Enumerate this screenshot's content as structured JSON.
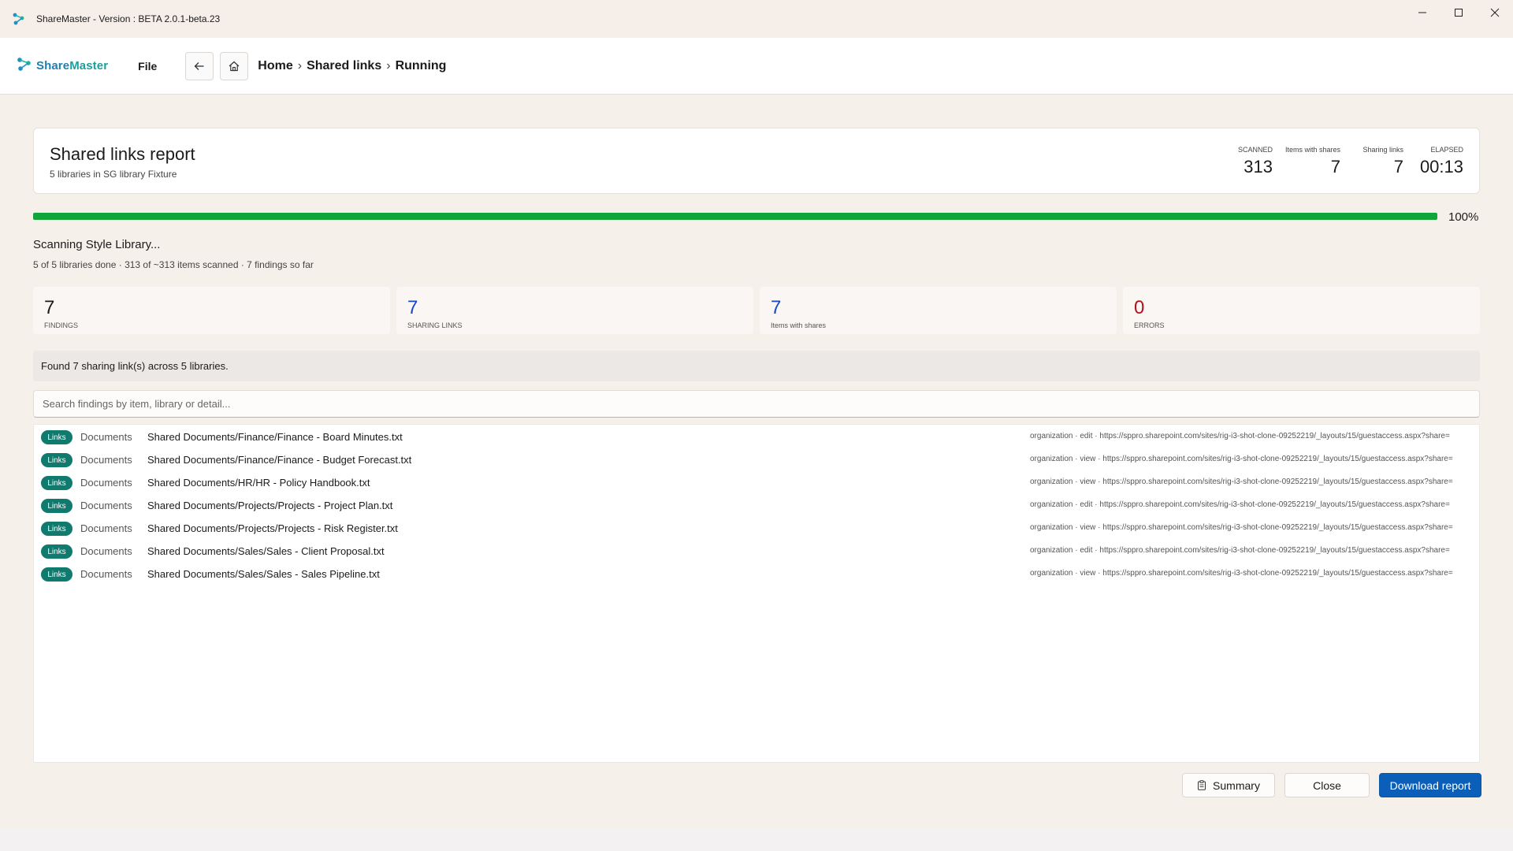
{
  "window": {
    "title": "ShareMaster - Version : BETA 2.0.1-beta.23"
  },
  "appbar": {
    "brand": {
      "part1": "Share",
      "part2": "Master"
    },
    "file_menu": "File",
    "breadcrumb": [
      "Home",
      "Shared links",
      "Running"
    ],
    "breadcrumb_sep": "›"
  },
  "report": {
    "title": "Shared links report",
    "subtitle": "5 libraries in SG library Fixture",
    "stats": [
      {
        "label": "SCANNED",
        "value": "313"
      },
      {
        "label": "Items with shares",
        "value": "7"
      },
      {
        "label": "Sharing links",
        "value": "7"
      },
      {
        "label": "ELAPSED",
        "value": "00:13"
      }
    ]
  },
  "progress": {
    "fraction": 1.0,
    "label": "100%",
    "status": "Scanning Style Library...",
    "detail": "5 of 5 libraries done · 313 of ~313 items scanned · 7 findings so far"
  },
  "tiles": [
    {
      "value": "7",
      "label": "FINDINGS",
      "color": "#1b1b1b"
    },
    {
      "value": "7",
      "label": "SHARING LINKS",
      "color": "#1747c9"
    },
    {
      "value": "7",
      "label": "Items with shares",
      "color": "#1747c9"
    },
    {
      "value": "0",
      "label": "ERRORS",
      "color": "#b1121b"
    }
  ],
  "info": "Found 7 sharing link(s) across 5 libraries.",
  "search": {
    "placeholder": "Search findings by item, library or detail..."
  },
  "findings": [
    {
      "badge": "Links",
      "library": "Documents",
      "path": "Shared Documents/Finance/Finance - Board Minutes.txt",
      "detail": "organization · edit · https://sppro.sharepoint.com/sites/rig-i3-shot-clone-09252219/_layouts/15/guestaccess.aspx?share="
    },
    {
      "badge": "Links",
      "library": "Documents",
      "path": "Shared Documents/Finance/Finance - Budget Forecast.txt",
      "detail": "organization · view · https://sppro.sharepoint.com/sites/rig-i3-shot-clone-09252219/_layouts/15/guestaccess.aspx?share="
    },
    {
      "badge": "Links",
      "library": "Documents",
      "path": "Shared Documents/HR/HR - Policy Handbook.txt",
      "detail": "organization · view · https://sppro.sharepoint.com/sites/rig-i3-shot-clone-09252219/_layouts/15/guestaccess.aspx?share="
    },
    {
      "badge": "Links",
      "library": "Documents",
      "path": "Shared Documents/Projects/Projects - Project Plan.txt",
      "detail": "organization · edit · https://sppro.sharepoint.com/sites/rig-i3-shot-clone-09252219/_layouts/15/guestaccess.aspx?share="
    },
    {
      "badge": "Links",
      "library": "Documents",
      "path": "Shared Documents/Projects/Projects - Risk Register.txt",
      "detail": "organization · view · https://sppro.sharepoint.com/sites/rig-i3-shot-clone-09252219/_layouts/15/guestaccess.aspx?share="
    },
    {
      "badge": "Links",
      "library": "Documents",
      "path": "Shared Documents/Sales/Sales - Client Proposal.txt",
      "detail": "organization · edit · https://sppro.sharepoint.com/sites/rig-i3-shot-clone-09252219/_layouts/15/guestaccess.aspx?share="
    },
    {
      "badge": "Links",
      "library": "Documents",
      "path": "Shared Documents/Sales/Sales - Sales Pipeline.txt",
      "detail": "organization · view · https://sppro.sharepoint.com/sites/rig-i3-shot-clone-09252219/_layouts/15/guestaccess.aspx?share="
    }
  ],
  "actions": {
    "summary": "Summary",
    "close": "Close",
    "download": "Download report"
  },
  "colors": {
    "accent": "#0b5fb8",
    "progress": "#12a53a",
    "badge": "#0f7a6d",
    "brand": "#1f7fae"
  },
  "icons": {
    "app": "sharemaster-logo-icon",
    "back": "arrow-left-icon",
    "home": "home-icon",
    "summary": "clipboard-icon"
  }
}
